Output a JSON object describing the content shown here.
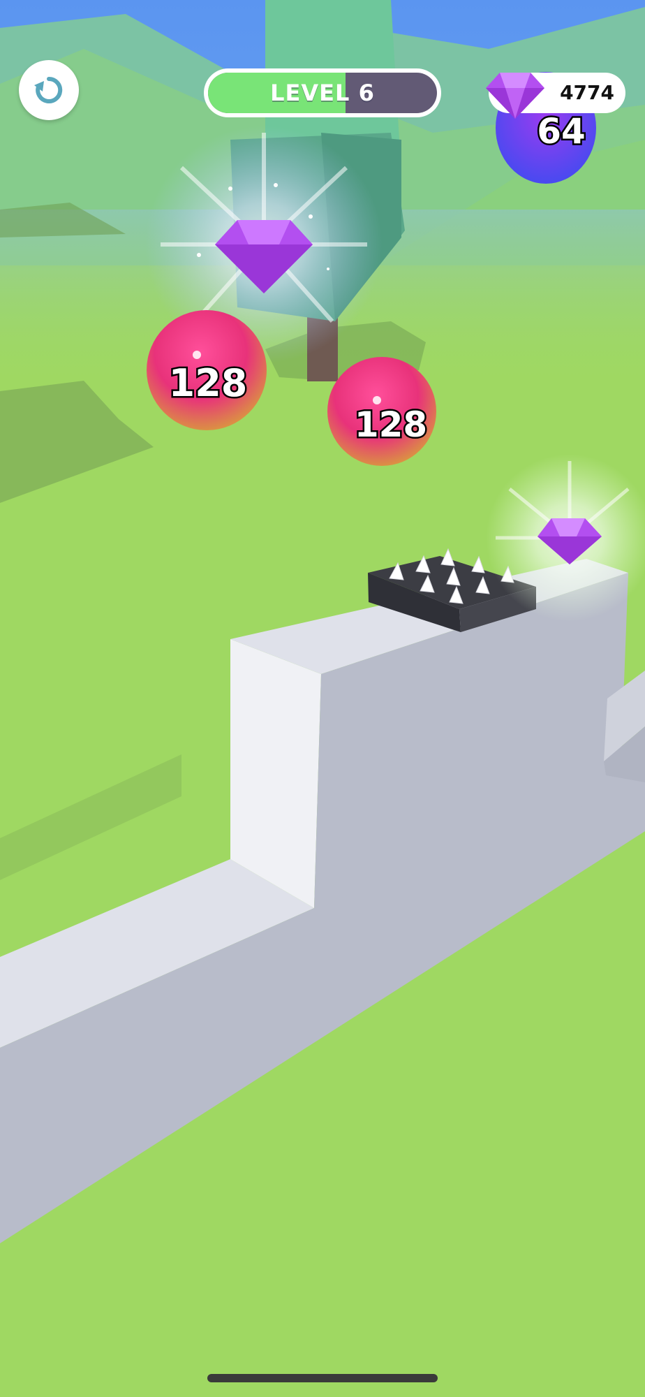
{
  "hud": {
    "level_label": "LEVEL 6",
    "level_progress": 0.6,
    "gem_count": "4774"
  },
  "balls": [
    {
      "name": "ball-128-left",
      "value": "128",
      "color": "#e8327a"
    },
    {
      "name": "ball-128-right",
      "value": "128",
      "color": "#e8327a"
    },
    {
      "name": "ball-64",
      "value": "64",
      "color": "#7a2ee6"
    }
  ],
  "colors": {
    "sky": "#5b95f0",
    "grass": "#9fd862",
    "wall_top": "#dfe1ea",
    "wall_side": "#b8bcca",
    "gem": "#b34ff0",
    "level_fill": "#79e477",
    "level_track": "#625a75"
  },
  "icons": {
    "restart": "restart-icon",
    "gem": "gem-icon",
    "spike_trap": "spike-trap-icon"
  }
}
